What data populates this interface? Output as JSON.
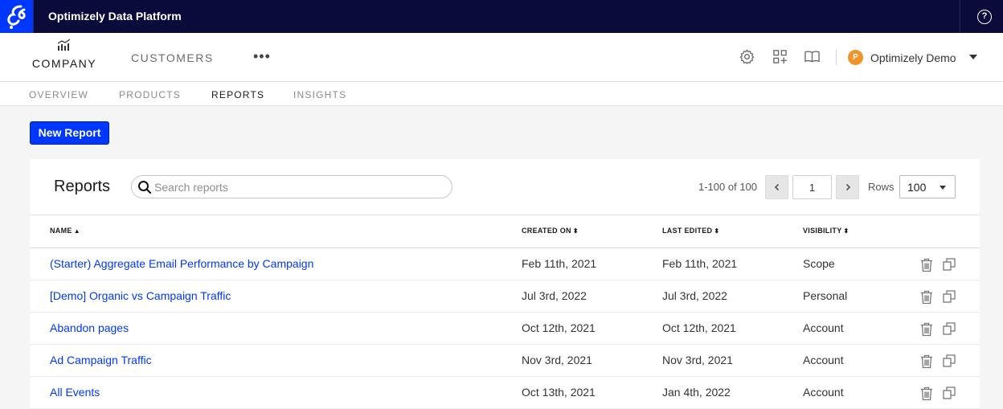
{
  "app": {
    "title": "Optimizely Data Platform"
  },
  "nav": {
    "company_label": "COMPANY",
    "customers_label": "CUSTOMERS",
    "more_label": "•••",
    "user": {
      "initial": "P",
      "name": "Optimizely Demo"
    },
    "icons": [
      "settings-icon",
      "apps-grid-icon",
      "book-icon"
    ]
  },
  "subnav": {
    "tabs": [
      {
        "label": "OVERVIEW",
        "active": false
      },
      {
        "label": "PRODUCTS",
        "active": false
      },
      {
        "label": "REPORTS",
        "active": true
      },
      {
        "label": "INSIGHTS",
        "active": false
      }
    ]
  },
  "toolbar": {
    "new_report_label": "New Report"
  },
  "reports": {
    "title": "Reports",
    "search_placeholder": "Search reports",
    "page_info": "1-100 of 100",
    "page_value": "1",
    "rows_label": "Rows",
    "rows_value": "100"
  },
  "table": {
    "columns": [
      {
        "label": "NAME",
        "sort": "▲"
      },
      {
        "label": "CREATED ON",
        "sort": "⬍"
      },
      {
        "label": "LAST EDITED",
        "sort": "⬍"
      },
      {
        "label": "VISIBILITY",
        "sort": "⬍"
      }
    ],
    "rows": [
      {
        "name": "(Starter) Aggregate Email Performance by Campaign",
        "created": "Feb 11th, 2021",
        "edited": "Feb 11th, 2021",
        "visibility": "Scope"
      },
      {
        "name": "[Demo] Organic vs Campaign Traffic",
        "created": "Jul 3rd, 2022",
        "edited": "Jul 3rd, 2022",
        "visibility": "Personal"
      },
      {
        "name": "Abandon pages",
        "created": "Oct 12th, 2021",
        "edited": "Oct 12th, 2021",
        "visibility": "Account"
      },
      {
        "name": "Ad Campaign Traffic",
        "created": "Nov 3rd, 2021",
        "edited": "Nov 3rd, 2021",
        "visibility": "Account"
      },
      {
        "name": "All Events",
        "created": "Oct 13th, 2021",
        "edited": "Jan 4th, 2022",
        "visibility": "Account"
      }
    ]
  },
  "colors": {
    "brand": "#0037ff",
    "topbar": "#0b0b3b",
    "avatar": "#f0932b"
  }
}
